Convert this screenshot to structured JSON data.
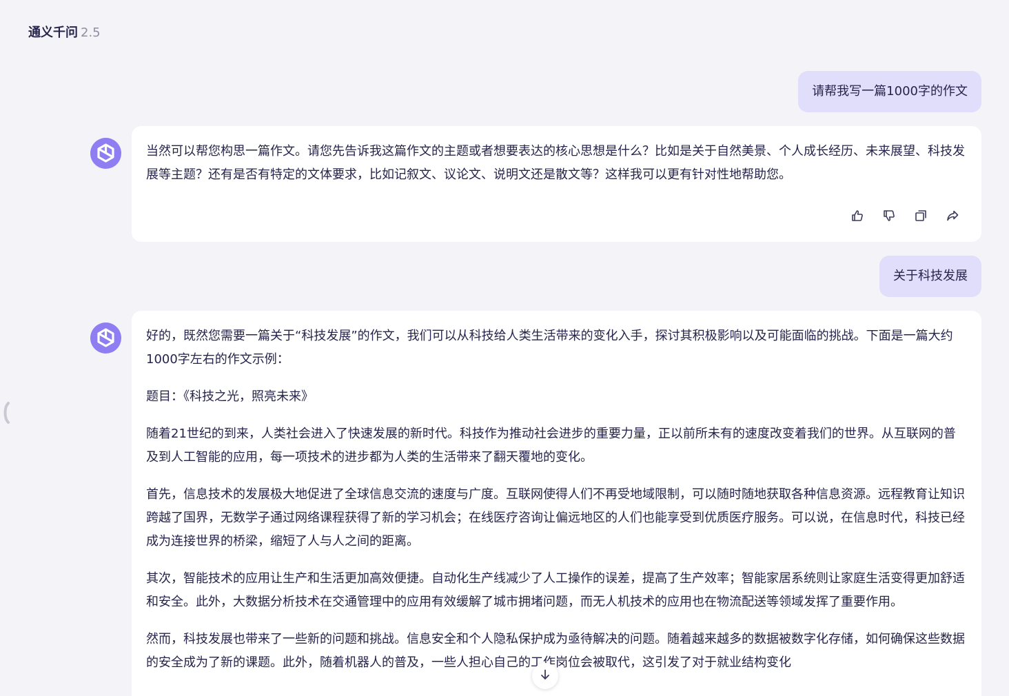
{
  "header": {
    "name": "通义千问",
    "version": "2.5"
  },
  "conversation": {
    "user_1": "请帮我写一篇1000字的作文",
    "bot_1": {
      "paragraphs": [
        "当然可以帮您构思一篇作文。请您先告诉我这篇作文的主题或者想要表达的核心思想是什么？比如是关于自然美景、个人成长经历、未来展望、科技发展等主题？还有是否有特定的文体要求，比如记叙文、议论文、说明文还是散文等？这样我可以更有针对性地帮助您。"
      ],
      "actions": [
        "thumbs-up-icon",
        "thumbs-down-icon",
        "copy-icon",
        "share-icon"
      ]
    },
    "user_2": "关于科技发展",
    "bot_2": {
      "paragraphs": [
        "好的，既然您需要一篇关于“科技发展”的作文，我们可以从科技给人类生活带来的变化入手，探讨其积极影响以及可能面临的挑战。下面是一篇大约1000字左右的作文示例：",
        "题目：《科技之光，照亮未来》",
        "随着21世纪的到来，人类社会进入了快速发展的新时代。科技作为推动社会进步的重要力量，正以前所未有的速度改变着我们的世界。从互联网的普及到人工智能的应用，每一项技术的进步都为人类的生活带来了翻天覆地的变化。",
        "首先，信息技术的发展极大地促进了全球信息交流的速度与广度。互联网使得人们不再受地域限制，可以随时随地获取各种信息资源。远程教育让知识跨越了国界，无数学子通过网络课程获得了新的学习机会；在线医疗咨询让偏远地区的人们也能享受到优质医疗服务。可以说，在信息时代，科技已经成为连接世界的桥梁，缩短了人与人之间的距离。",
        "其次，智能技术的应用让生产和生活更加高效便捷。自动化生产线减少了人工操作的误差，提高了生产效率；智能家居系统则让家庭生活变得更加舒适和安全。此外，大数据分析技术在交通管理中的应用有效缓解了城市拥堵问题，而无人机技术的应用也在物流配送等领域发挥了重要作用。",
        "然而，科技发展也带来了一些新的问题和挑战。信息安全和个人隐私保护成为亟待解决的问题。随着越来越多的数据被数字化存储，如何确保这些数据的安全成为了新的课题。此外，随着机器人的普及，一些人担心自己的工作岗位会被取代，这引发了对于就业结构变化"
      ]
    }
  },
  "colors": {
    "background": "#f4f4f8",
    "user_bubble": "#e0defa",
    "avatar": "#8f7ef2",
    "text": "#26244c"
  },
  "icons": {
    "scroll_down": "arrow-down-icon",
    "avatar": "qwen-logo-icon",
    "sidebar_handle": "collapse-handle-icon"
  }
}
